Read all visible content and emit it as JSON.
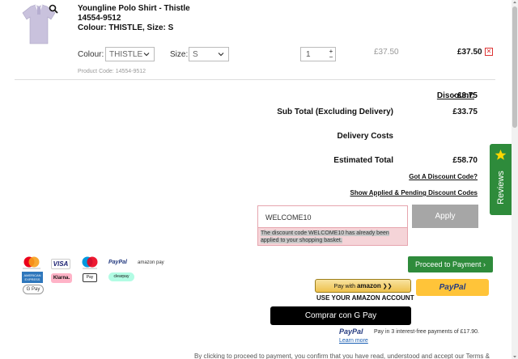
{
  "product": {
    "title": "Youngline Polo Shirt - Thistle",
    "sku": "14554-9512",
    "colour_size": "Colour: THISTLE, Size: S",
    "colour_label": "Colour:",
    "colour_value": "THISTLE",
    "size_label": "Size:",
    "size_value": "S",
    "quantity": "1",
    "unit_price": "£37.50",
    "line_price": "£37.50",
    "product_code": "Product Code: 14554-9512",
    "thumb_color": "#c9c2dd"
  },
  "summary": {
    "discount_label": "Discount:",
    "discount_value": "- £3.75",
    "subtotal_label": "Sub Total (Excluding Delivery)",
    "subtotal_value": "£33.75",
    "delivery_label": "Delivery Costs",
    "estimated_label": "Estimated Total",
    "estimated_value": "£58.70",
    "discount_code_link": "Got A Discount Code?",
    "applied_link": "Show Applied & Pending Discount Codes"
  },
  "discount_form": {
    "input_value": "WELCOME10",
    "error_message": "The discount code WELCOME10 has already been applied to your shopping basket.",
    "apply_label": "Apply"
  },
  "payment_methods": [
    {
      "name": "mastercard"
    },
    {
      "name": "visa",
      "label": "VISA"
    },
    {
      "name": "maestro"
    },
    {
      "name": "paypal",
      "label": "PayPal"
    },
    {
      "name": "amazon-pay",
      "label": "amazon pay"
    },
    {
      "name": "american-express",
      "label": "AMERICAN EXPRESS"
    },
    {
      "name": "klarna",
      "label": "Klarna."
    },
    {
      "name": "apple-pay",
      "label": "Pay"
    },
    {
      "name": "clearpay",
      "label": "clearpay"
    },
    {
      "name": "google-pay",
      "label": "G Pay"
    }
  ],
  "checkout": {
    "proceed_label": "Proceed to Payment ›",
    "amazon_btn_prefix": "Pay with",
    "amazon_btn_brand": "amazon",
    "amazon_caption": "USE YOUR AMAZON ACCOUNT",
    "paypal_label": "PayPal",
    "gpay_label": "Comprar con G Pay",
    "paypal_pay_logo": "PayPal",
    "paypal_pay_text": "Pay in 3 interest-free payments of £17.90.",
    "learn_more": "Learn more"
  },
  "disclaimer": "By clicking to proceed to payment, you confirm that you have read, understood and accept our Terms &",
  "reviews_tab": {
    "label": "Reviews",
    "color": "#2e8b3b"
  },
  "colors": {
    "accent_green": "#2e8b3b",
    "error_bg": "#f5d4d8",
    "error_border": "#e6a5ae",
    "paypal_yellow": "#ffc439",
    "remove_red": "#dd3333"
  }
}
